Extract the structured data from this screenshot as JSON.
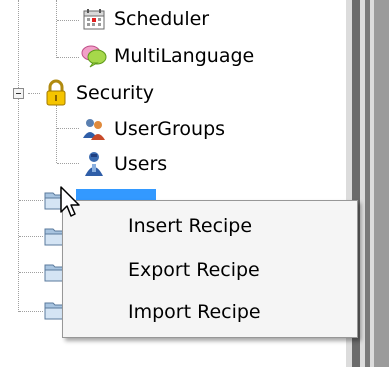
{
  "tree": {
    "items": [
      {
        "label": "Scheduler",
        "icon": "calendar-icon"
      },
      {
        "label": "MultiLanguage",
        "icon": "speech-bubble-icon"
      },
      {
        "label": "Security",
        "icon": "padlock-icon"
      },
      {
        "label": "UserGroups",
        "icon": "user-group-icon"
      },
      {
        "label": "Users",
        "icon": "user-icon"
      }
    ],
    "folders": [
      "folder-icon",
      "folder-icon",
      "folder-icon",
      "folder-icon"
    ]
  },
  "context_menu": {
    "items": [
      {
        "label": "Insert Recipe"
      },
      {
        "label": "Export Recipe"
      },
      {
        "label": "Import Recipe"
      }
    ]
  },
  "colors": {
    "selection": "#3399ff",
    "menu_background": "#f5f5f5"
  }
}
